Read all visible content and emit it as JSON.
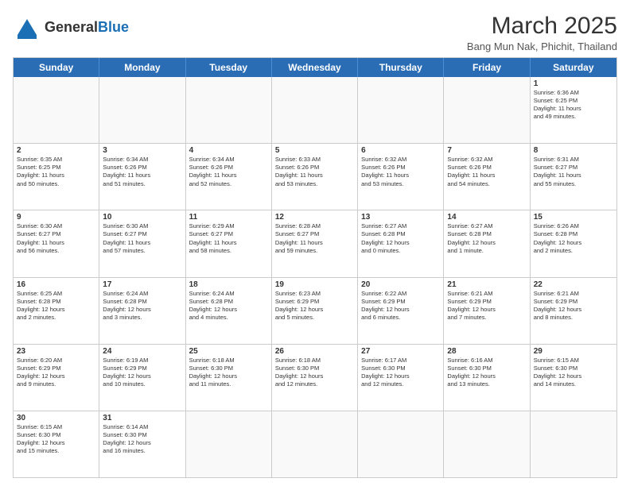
{
  "header": {
    "logo_general": "General",
    "logo_blue": "Blue",
    "month_year": "March 2025",
    "location": "Bang Mun Nak, Phichit, Thailand"
  },
  "weekdays": [
    "Sunday",
    "Monday",
    "Tuesday",
    "Wednesday",
    "Thursday",
    "Friday",
    "Saturday"
  ],
  "rows": [
    [
      {
        "day": "",
        "info": ""
      },
      {
        "day": "",
        "info": ""
      },
      {
        "day": "",
        "info": ""
      },
      {
        "day": "",
        "info": ""
      },
      {
        "day": "",
        "info": ""
      },
      {
        "day": "",
        "info": ""
      },
      {
        "day": "1",
        "info": "Sunrise: 6:36 AM\nSunset: 6:25 PM\nDaylight: 11 hours\nand 49 minutes."
      }
    ],
    [
      {
        "day": "2",
        "info": "Sunrise: 6:35 AM\nSunset: 6:25 PM\nDaylight: 11 hours\nand 50 minutes."
      },
      {
        "day": "3",
        "info": "Sunrise: 6:34 AM\nSunset: 6:26 PM\nDaylight: 11 hours\nand 51 minutes."
      },
      {
        "day": "4",
        "info": "Sunrise: 6:34 AM\nSunset: 6:26 PM\nDaylight: 11 hours\nand 52 minutes."
      },
      {
        "day": "5",
        "info": "Sunrise: 6:33 AM\nSunset: 6:26 PM\nDaylight: 11 hours\nand 53 minutes."
      },
      {
        "day": "6",
        "info": "Sunrise: 6:32 AM\nSunset: 6:26 PM\nDaylight: 11 hours\nand 53 minutes."
      },
      {
        "day": "7",
        "info": "Sunrise: 6:32 AM\nSunset: 6:26 PM\nDaylight: 11 hours\nand 54 minutes."
      },
      {
        "day": "8",
        "info": "Sunrise: 6:31 AM\nSunset: 6:27 PM\nDaylight: 11 hours\nand 55 minutes."
      }
    ],
    [
      {
        "day": "9",
        "info": "Sunrise: 6:30 AM\nSunset: 6:27 PM\nDaylight: 11 hours\nand 56 minutes."
      },
      {
        "day": "10",
        "info": "Sunrise: 6:30 AM\nSunset: 6:27 PM\nDaylight: 11 hours\nand 57 minutes."
      },
      {
        "day": "11",
        "info": "Sunrise: 6:29 AM\nSunset: 6:27 PM\nDaylight: 11 hours\nand 58 minutes."
      },
      {
        "day": "12",
        "info": "Sunrise: 6:28 AM\nSunset: 6:27 PM\nDaylight: 11 hours\nand 59 minutes."
      },
      {
        "day": "13",
        "info": "Sunrise: 6:27 AM\nSunset: 6:28 PM\nDaylight: 12 hours\nand 0 minutes."
      },
      {
        "day": "14",
        "info": "Sunrise: 6:27 AM\nSunset: 6:28 PM\nDaylight: 12 hours\nand 1 minute."
      },
      {
        "day": "15",
        "info": "Sunrise: 6:26 AM\nSunset: 6:28 PM\nDaylight: 12 hours\nand 2 minutes."
      }
    ],
    [
      {
        "day": "16",
        "info": "Sunrise: 6:25 AM\nSunset: 6:28 PM\nDaylight: 12 hours\nand 2 minutes."
      },
      {
        "day": "17",
        "info": "Sunrise: 6:24 AM\nSunset: 6:28 PM\nDaylight: 12 hours\nand 3 minutes."
      },
      {
        "day": "18",
        "info": "Sunrise: 6:24 AM\nSunset: 6:28 PM\nDaylight: 12 hours\nand 4 minutes."
      },
      {
        "day": "19",
        "info": "Sunrise: 6:23 AM\nSunset: 6:29 PM\nDaylight: 12 hours\nand 5 minutes."
      },
      {
        "day": "20",
        "info": "Sunrise: 6:22 AM\nSunset: 6:29 PM\nDaylight: 12 hours\nand 6 minutes."
      },
      {
        "day": "21",
        "info": "Sunrise: 6:21 AM\nSunset: 6:29 PM\nDaylight: 12 hours\nand 7 minutes."
      },
      {
        "day": "22",
        "info": "Sunrise: 6:21 AM\nSunset: 6:29 PM\nDaylight: 12 hours\nand 8 minutes."
      }
    ],
    [
      {
        "day": "23",
        "info": "Sunrise: 6:20 AM\nSunset: 6:29 PM\nDaylight: 12 hours\nand 9 minutes."
      },
      {
        "day": "24",
        "info": "Sunrise: 6:19 AM\nSunset: 6:29 PM\nDaylight: 12 hours\nand 10 minutes."
      },
      {
        "day": "25",
        "info": "Sunrise: 6:18 AM\nSunset: 6:30 PM\nDaylight: 12 hours\nand 11 minutes."
      },
      {
        "day": "26",
        "info": "Sunrise: 6:18 AM\nSunset: 6:30 PM\nDaylight: 12 hours\nand 12 minutes."
      },
      {
        "day": "27",
        "info": "Sunrise: 6:17 AM\nSunset: 6:30 PM\nDaylight: 12 hours\nand 12 minutes."
      },
      {
        "day": "28",
        "info": "Sunrise: 6:16 AM\nSunset: 6:30 PM\nDaylight: 12 hours\nand 13 minutes."
      },
      {
        "day": "29",
        "info": "Sunrise: 6:15 AM\nSunset: 6:30 PM\nDaylight: 12 hours\nand 14 minutes."
      }
    ],
    [
      {
        "day": "30",
        "info": "Sunrise: 6:15 AM\nSunset: 6:30 PM\nDaylight: 12 hours\nand 15 minutes."
      },
      {
        "day": "31",
        "info": "Sunrise: 6:14 AM\nSunset: 6:30 PM\nDaylight: 12 hours\nand 16 minutes."
      },
      {
        "day": "",
        "info": ""
      },
      {
        "day": "",
        "info": ""
      },
      {
        "day": "",
        "info": ""
      },
      {
        "day": "",
        "info": ""
      },
      {
        "day": "",
        "info": ""
      }
    ]
  ]
}
